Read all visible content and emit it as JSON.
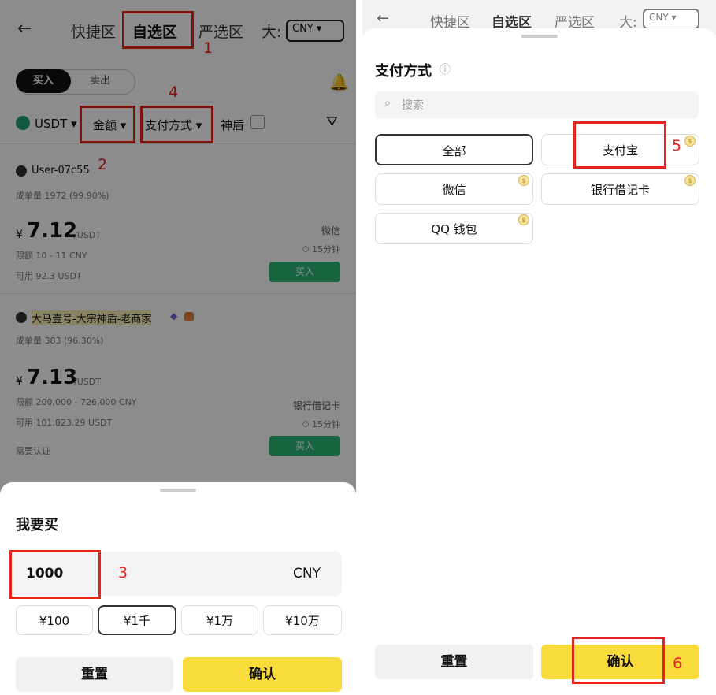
{
  "left": {
    "nav": {
      "back": "←",
      "tab_quick": "快捷区",
      "tab_fav": "自选区",
      "tab_strict": "严选区",
      "tab_big": "大:",
      "currency": "CNY ▾"
    },
    "annotations": {
      "n1": "1",
      "n2": "2",
      "n3": "3",
      "n4": "4"
    },
    "trade_tabs": {
      "buy": "买入",
      "sell": "卖出"
    },
    "filters": {
      "coin": "USDT ▾",
      "amount": "金额 ▾",
      "payment": "支付方式 ▾",
      "shield": "神盾"
    },
    "listings": [
      {
        "user": "User-07c55",
        "orders": "成单量 1972 (99.90%)",
        "price_symbol": "¥",
        "price": "7.12",
        "unit": "/USDT",
        "limit": "限额 10 - 11 CNY",
        "available": "可用 92.3 USDT",
        "method": "微信",
        "time": "⏱ 15分钟",
        "buy": "买入"
      },
      {
        "user": "大马壹号-大宗神盾-老商家",
        "orders": "成单量 383 (96.30%)",
        "price_symbol": "¥",
        "price": "7.13",
        "unit": "/USDT",
        "limit": "限额 200,000 - 726,000 CNY",
        "available": "可用 101,823.29 USDT",
        "method": "银行借记卡",
        "time": "⏱ 15分钟",
        "verify": "需要认证",
        "buy": "买入"
      }
    ],
    "sheet": {
      "title": "我要买",
      "amount_value": "1000",
      "amount_currency": "CNY",
      "presets": [
        "¥100",
        "¥1千",
        "¥1万",
        "¥10万"
      ],
      "reset": "重置",
      "confirm": "确认"
    }
  },
  "right": {
    "nav": {
      "back": "←",
      "tab_quick": "快捷区",
      "tab_fav": "自选区",
      "tab_strict": "严选区",
      "tab_big": "大:",
      "currency": "CNY ▾"
    },
    "title": "支付方式",
    "info_icon": "ⓘ",
    "search_placeholder": "搜索",
    "methods": [
      "全部",
      "支付宝",
      "微信",
      "银行借记卡",
      "QQ 钱包"
    ],
    "annotations": {
      "n5": "5",
      "n6": "6"
    },
    "reset": "重置",
    "confirm": "确认"
  },
  "colors": {
    "accent_yellow": "#f9dc3a",
    "green": "#2bb673",
    "annotation_red": "#e8231b"
  }
}
